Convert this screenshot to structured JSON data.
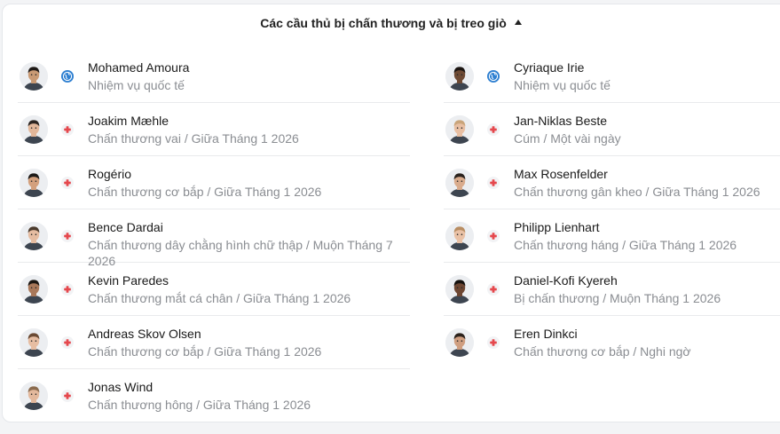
{
  "header": {
    "title": "Các cầu thủ bị chấn thương và bị treo giò"
  },
  "left_players": [
    {
      "name": "Mohamed Amoura",
      "detail": "Nhiệm vụ quốc tế",
      "status_icon": "globe-icon",
      "skin": "#c99a74",
      "hair": "#1f1a17"
    },
    {
      "name": "Joakim Mæhle",
      "detail": "Chấn thương vai / Giữa Tháng 1 2026",
      "status_icon": "injury-cross-icon",
      "skin": "#e2b79a",
      "hair": "#2b2420"
    },
    {
      "name": "Rogério",
      "detail": "Chấn thương cơ bắp / Giữa Tháng 1 2026",
      "status_icon": "injury-cross-icon",
      "skin": "#d3a07d",
      "hair": "#1d1a18"
    },
    {
      "name": "Bence Dardai",
      "detail": "Chấn thương dây chằng hình chữ thập / Muộn Tháng 7 2026",
      "status_icon": "injury-cross-icon",
      "skin": "#e5bca1",
      "hair": "#4a3a2c"
    },
    {
      "name": "Kevin Paredes",
      "detail": "Chấn thương mắt cá chân / Giữa Tháng 1 2026",
      "status_icon": "injury-cross-icon",
      "skin": "#a9785a",
      "hair": "#1b1612"
    },
    {
      "name": "Andreas Skov Olsen",
      "detail": "Chấn thương cơ bắp / Giữa Tháng 1 2026",
      "status_icon": "injury-cross-icon",
      "skin": "#e6bda2",
      "hair": "#6b4a33"
    },
    {
      "name": "Jonas Wind",
      "detail": "Chấn thương hông / Giữa Tháng 1 2026",
      "status_icon": "injury-cross-icon",
      "skin": "#e3b89c",
      "hair": "#8a6b4e"
    }
  ],
  "right_players": [
    {
      "name": "Cyriaque Irie",
      "detail": "Nhiệm vụ quốc tế",
      "status_icon": "globe-icon",
      "skin": "#6e4a34",
      "hair": "#1a1411"
    },
    {
      "name": "Jan-Niklas Beste",
      "detail": "Cúm / Một vài ngày",
      "status_icon": "injury-cross-icon",
      "skin": "#e8bfa3",
      "hair": "#c9a47a"
    },
    {
      "name": "Max Rosenfelder",
      "detail": "Chấn thương gân kheo / Giữa Tháng 1 2026",
      "status_icon": "injury-cross-icon",
      "skin": "#d9ab8c",
      "hair": "#2a221d"
    },
    {
      "name": "Philipp Lienhart",
      "detail": "Chấn thương háng / Giữa Tháng 1 2026",
      "status_icon": "injury-cross-icon",
      "skin": "#e9c1a6",
      "hair": "#b88d62"
    },
    {
      "name": "Daniel-Kofi Kyereh",
      "detail": "Bị chấn thương / Muộn Tháng 1 2026",
      "status_icon": "injury-cross-icon",
      "skin": "#6d4632",
      "hair": "#15110e"
    },
    {
      "name": "Eren Dinkci",
      "detail": "Chấn thương cơ bắp / Nghi ngờ",
      "status_icon": "injury-cross-icon",
      "skin": "#cf9e80",
      "hair": "#2a211b"
    }
  ],
  "colors": {
    "injury": "#e5484d",
    "international": "#2f80d1",
    "muted_text": "#8a8d92"
  }
}
